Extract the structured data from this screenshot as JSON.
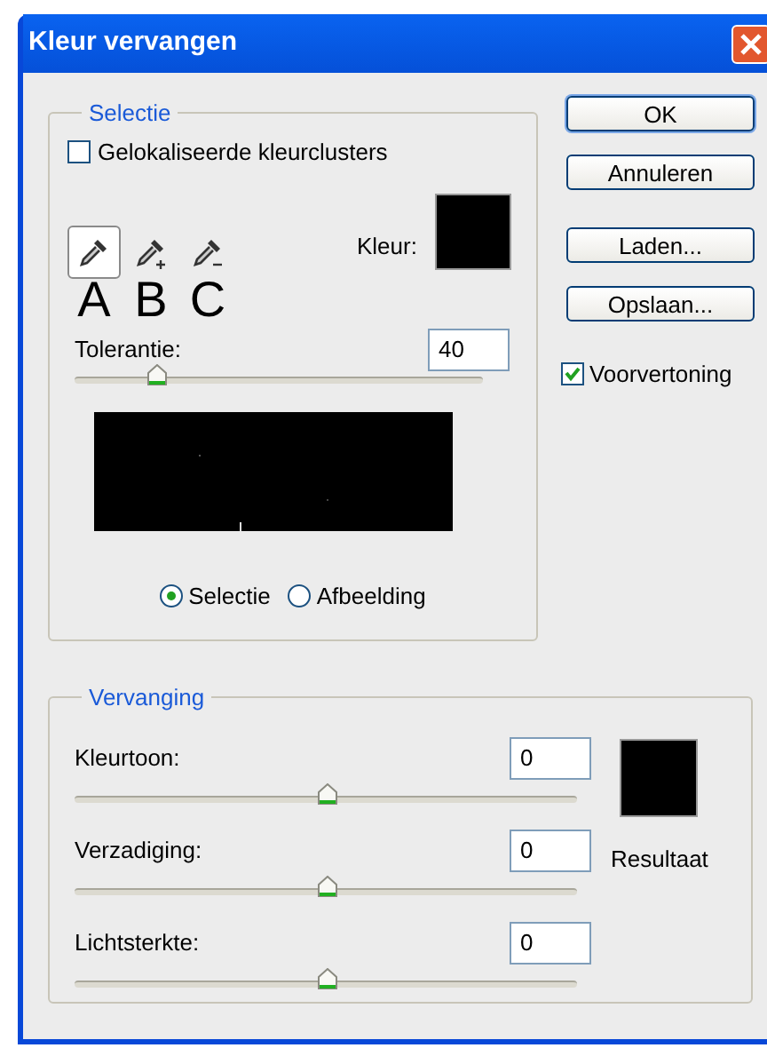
{
  "window": {
    "title": "Kleur vervangen"
  },
  "selection": {
    "legend": "Selectie",
    "localized_clusters": {
      "label": "Gelokaliseerde kleurclusters",
      "checked": false
    },
    "tools": [
      {
        "kind": "plain",
        "letter": "A",
        "selected": true
      },
      {
        "kind": "plus",
        "letter": "B",
        "selected": false
      },
      {
        "kind": "minus",
        "letter": "C",
        "selected": false
      }
    ],
    "color_label": "Kleur:",
    "tolerance": {
      "label": "Tolerantie:",
      "value": "40",
      "level": 0.2
    },
    "view": [
      {
        "label": "Selectie",
        "selected": true
      },
      {
        "label": "Afbeelding",
        "selected": false
      }
    ]
  },
  "buttons": [
    "OK",
    "Annuleren",
    "Laden...",
    "Opslaan..."
  ],
  "preview": {
    "label": "Voorvertoning",
    "checked": true
  },
  "replacement": {
    "legend": "Vervanging",
    "sliders": [
      {
        "label": "Kleurtoon:",
        "value": "0",
        "level": 0.5
      },
      {
        "label": "Verzadiging:",
        "value": "0",
        "level": 0.5
      },
      {
        "label": "Lichtsterkte:",
        "value": "0",
        "level": 0.5
      }
    ],
    "result_label": "Resultaat"
  }
}
